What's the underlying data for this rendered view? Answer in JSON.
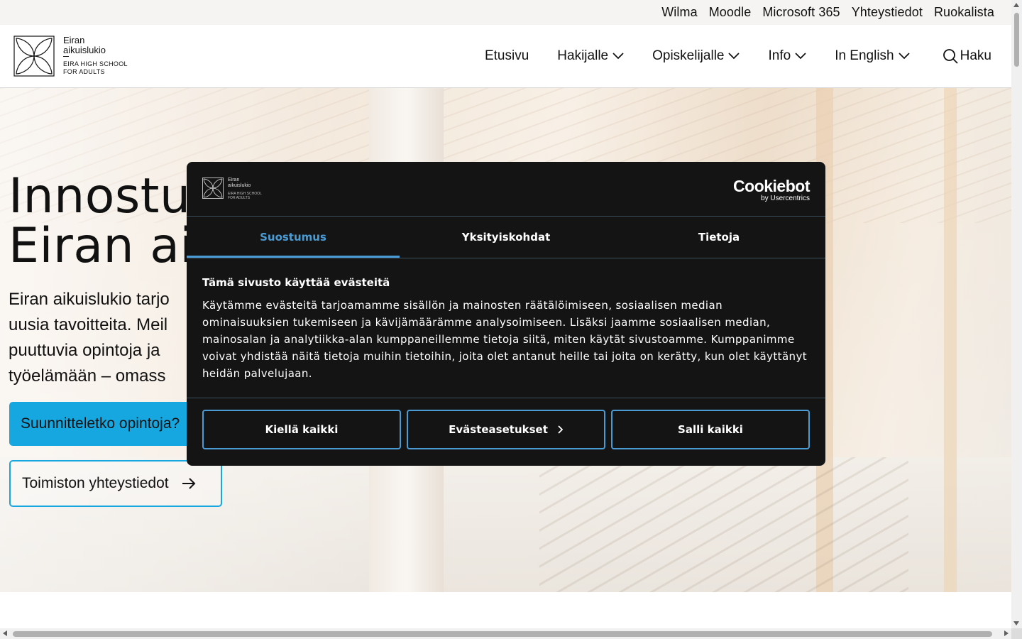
{
  "utility_nav": [
    "Wilma",
    "Moodle",
    "Microsoft 365",
    "Yhteystiedot",
    "Ruokalista"
  ],
  "logo": {
    "line1": "Eiran",
    "line2": "aikuislukio",
    "line3": "EIRA HIGH SCHOOL",
    "line4": "FOR ADULTS"
  },
  "main_nav": {
    "home": "Etusivu",
    "applicant": "Hakijalle",
    "student": "Opiskelijalle",
    "info": "Info",
    "english": "In English",
    "search": "Haku"
  },
  "hero": {
    "title_line1": "Innostu",
    "title_line2": "Eiran ai",
    "text_line1": "Eiran aikuislukio tarjo",
    "text_line2": "uusia tavoitteita. Meil",
    "text_line3": "puuttuvia opintoja ja",
    "text_line4": "työelämään – omass",
    "primary_button": "Suunnitteletko opintoja?",
    "secondary_button": "Toimiston yhteystiedot"
  },
  "cookie_banner": {
    "brand": "Cookiebot",
    "brand_by": "by Usercentrics",
    "tabs": [
      "Suostumus",
      "Yksityiskohdat",
      "Tietoja"
    ],
    "active_tab": "Suostumus",
    "heading": "Tämä sivusto käyttää evästeitä",
    "body": "Käytämme evästeitä tarjoamamme sisällön ja mainosten räätälöimiseen, sosiaalisen median ominaisuuksien tukemiseen ja kävijämäärämme analysoimiseen. Lisäksi jaamme sosiaalisen median, mainosalan ja analytiikka-alan kumppaneillemme tietoja siitä, miten käytät sivustoamme. Kumppanimme voivat yhdistää näitä tietoja muihin tietoihin, joita olet antanut heille tai joita on kerätty, kun olet käyttänyt heidän palvelujaan.",
    "deny_button": "Kiellä kaikki",
    "settings_button": "Evästeasetukset",
    "allow_button": "Salli kaikki"
  },
  "colors": {
    "accent": "#16a6e0",
    "cookie_accent": "#4a9bd4",
    "cookie_bg": "#141414"
  }
}
